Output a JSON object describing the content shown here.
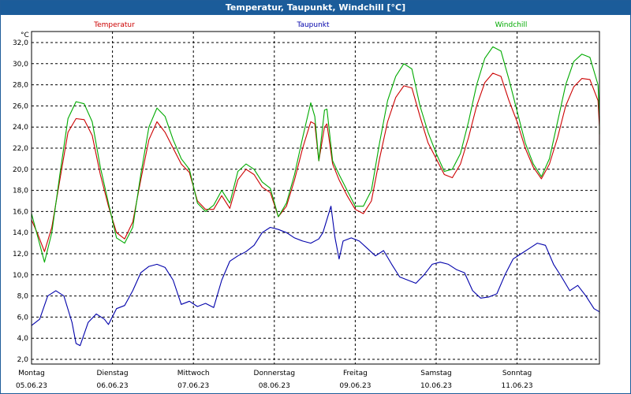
{
  "title": "Temperatur, Taupunkt, Windchill [°C]",
  "chart_data": {
    "type": "line",
    "unit_label": "°C",
    "ylim": [
      2.0,
      32.0
    ],
    "y_ticks": [
      "2,0",
      "4,0",
      "6,0",
      "8,0",
      "10,0",
      "12,0",
      "14,0",
      "16,0",
      "18,0",
      "20,0",
      "22,0",
      "24,0",
      "26,0",
      "28,0",
      "30,0",
      "32,0"
    ],
    "x_days": [
      {
        "day": "Montag",
        "date": "05.06.23"
      },
      {
        "day": "Dienstag",
        "date": "06.06.23"
      },
      {
        "day": "Mittwoch",
        "date": "07.06.23"
      },
      {
        "day": "Donnerstag",
        "date": "08.06.23"
      },
      {
        "day": "Freitag",
        "date": "09.06.23"
      },
      {
        "day": "Samstag",
        "date": "10.06.23"
      },
      {
        "day": "Sonntag",
        "date": "11.06.23"
      }
    ],
    "grid": true,
    "series": [
      {
        "name": "Temperatur",
        "color": "#cc0000",
        "points": [
          [
            0.0,
            15.2
          ],
          [
            0.08,
            13.8
          ],
          [
            0.16,
            12.2
          ],
          [
            0.25,
            14.5
          ],
          [
            0.35,
            19.0
          ],
          [
            0.45,
            23.5
          ],
          [
            0.55,
            24.8
          ],
          [
            0.65,
            24.7
          ],
          [
            0.75,
            23.2
          ],
          [
            0.85,
            19.5
          ],
          [
            0.95,
            16.5
          ],
          [
            1.05,
            14.0
          ],
          [
            1.15,
            13.4
          ],
          [
            1.25,
            15.0
          ],
          [
            1.35,
            19.0
          ],
          [
            1.45,
            22.8
          ],
          [
            1.55,
            24.5
          ],
          [
            1.65,
            23.5
          ],
          [
            1.75,
            22.0
          ],
          [
            1.85,
            20.5
          ],
          [
            1.95,
            19.7
          ],
          [
            2.05,
            17.0
          ],
          [
            2.15,
            16.2
          ],
          [
            2.25,
            16.2
          ],
          [
            2.35,
            17.5
          ],
          [
            2.45,
            16.3
          ],
          [
            2.55,
            19.0
          ],
          [
            2.65,
            20.0
          ],
          [
            2.75,
            19.5
          ],
          [
            2.85,
            18.3
          ],
          [
            2.95,
            17.8
          ],
          [
            3.05,
            15.5
          ],
          [
            3.15,
            16.5
          ],
          [
            3.25,
            19.0
          ],
          [
            3.35,
            22.0
          ],
          [
            3.45,
            24.5
          ],
          [
            3.5,
            24.3
          ],
          [
            3.55,
            20.8
          ],
          [
            3.62,
            24.0
          ],
          [
            3.65,
            24.3
          ],
          [
            3.72,
            20.5
          ],
          [
            3.8,
            19.0
          ],
          [
            3.9,
            17.5
          ],
          [
            4.0,
            16.2
          ],
          [
            4.1,
            15.8
          ],
          [
            4.2,
            17.0
          ],
          [
            4.3,
            21.0
          ],
          [
            4.4,
            24.5
          ],
          [
            4.5,
            26.8
          ],
          [
            4.6,
            27.9
          ],
          [
            4.7,
            27.7
          ],
          [
            4.8,
            25.0
          ],
          [
            4.9,
            22.5
          ],
          [
            5.0,
            21.0
          ],
          [
            5.1,
            19.5
          ],
          [
            5.2,
            19.2
          ],
          [
            5.3,
            20.5
          ],
          [
            5.4,
            23.0
          ],
          [
            5.5,
            26.0
          ],
          [
            5.6,
            28.2
          ],
          [
            5.7,
            29.1
          ],
          [
            5.8,
            28.8
          ],
          [
            5.9,
            26.5
          ],
          [
            6.0,
            24.5
          ],
          [
            6.1,
            22.0
          ],
          [
            6.2,
            20.2
          ],
          [
            6.3,
            19.1
          ],
          [
            6.4,
            20.5
          ],
          [
            6.5,
            23.0
          ],
          [
            6.6,
            26.0
          ],
          [
            6.7,
            27.8
          ],
          [
            6.8,
            28.6
          ],
          [
            6.9,
            28.5
          ],
          [
            7.0,
            26.5
          ],
          [
            7.1,
            24.0
          ],
          [
            7.2,
            22.3
          ]
        ]
      },
      {
        "name": "Taupunkt",
        "color": "#0000aa",
        "points": [
          [
            0.0,
            5.2
          ],
          [
            0.1,
            5.8
          ],
          [
            0.2,
            8.0
          ],
          [
            0.3,
            8.5
          ],
          [
            0.4,
            8.0
          ],
          [
            0.5,
            5.5
          ],
          [
            0.55,
            3.5
          ],
          [
            0.6,
            3.3
          ],
          [
            0.7,
            5.5
          ],
          [
            0.8,
            6.3
          ],
          [
            0.9,
            5.8
          ],
          [
            0.95,
            5.3
          ],
          [
            1.05,
            6.8
          ],
          [
            1.15,
            7.1
          ],
          [
            1.25,
            8.5
          ],
          [
            1.35,
            10.2
          ],
          [
            1.45,
            10.8
          ],
          [
            1.55,
            11.0
          ],
          [
            1.65,
            10.7
          ],
          [
            1.75,
            9.5
          ],
          [
            1.85,
            7.2
          ],
          [
            1.95,
            7.5
          ],
          [
            2.05,
            7.0
          ],
          [
            2.15,
            7.3
          ],
          [
            2.25,
            6.9
          ],
          [
            2.35,
            9.5
          ],
          [
            2.45,
            11.3
          ],
          [
            2.55,
            11.8
          ],
          [
            2.65,
            12.2
          ],
          [
            2.75,
            12.8
          ],
          [
            2.85,
            14.0
          ],
          [
            2.95,
            14.5
          ],
          [
            3.05,
            14.3
          ],
          [
            3.15,
            14.0
          ],
          [
            3.25,
            13.5
          ],
          [
            3.35,
            13.2
          ],
          [
            3.45,
            13.0
          ],
          [
            3.55,
            13.4
          ],
          [
            3.6,
            14.0
          ],
          [
            3.7,
            16.5
          ],
          [
            3.75,
            13.5
          ],
          [
            3.8,
            11.5
          ],
          [
            3.85,
            13.2
          ],
          [
            3.95,
            13.5
          ],
          [
            4.05,
            13.2
          ],
          [
            4.15,
            12.5
          ],
          [
            4.25,
            11.8
          ],
          [
            4.35,
            12.3
          ],
          [
            4.45,
            11.0
          ],
          [
            4.55,
            9.8
          ],
          [
            4.65,
            9.5
          ],
          [
            4.75,
            9.2
          ],
          [
            4.85,
            10.0
          ],
          [
            4.95,
            11.0
          ],
          [
            5.05,
            11.2
          ],
          [
            5.15,
            11.0
          ],
          [
            5.25,
            10.5
          ],
          [
            5.35,
            10.2
          ],
          [
            5.45,
            8.5
          ],
          [
            5.55,
            7.8
          ],
          [
            5.65,
            7.9
          ],
          [
            5.75,
            8.2
          ],
          [
            5.85,
            10.0
          ],
          [
            5.95,
            11.5
          ],
          [
            6.05,
            12.0
          ],
          [
            6.15,
            12.5
          ],
          [
            6.25,
            13.0
          ],
          [
            6.35,
            12.8
          ],
          [
            6.45,
            11.0
          ],
          [
            6.55,
            9.8
          ],
          [
            6.65,
            8.5
          ],
          [
            6.75,
            9.0
          ],
          [
            6.85,
            8.0
          ],
          [
            6.95,
            6.8
          ],
          [
            7.05,
            6.5
          ],
          [
            7.15,
            6.3
          ]
        ]
      },
      {
        "name": "Windchill",
        "color": "#00aa00",
        "points": [
          [
            0.0,
            15.8
          ],
          [
            0.08,
            13.5
          ],
          [
            0.16,
            11.2
          ],
          [
            0.25,
            14.0
          ],
          [
            0.35,
            19.5
          ],
          [
            0.45,
            24.8
          ],
          [
            0.55,
            26.4
          ],
          [
            0.65,
            26.2
          ],
          [
            0.75,
            24.5
          ],
          [
            0.85,
            20.2
          ],
          [
            0.95,
            16.8
          ],
          [
            1.05,
            13.5
          ],
          [
            1.15,
            13.0
          ],
          [
            1.25,
            14.5
          ],
          [
            1.35,
            19.5
          ],
          [
            1.45,
            24.0
          ],
          [
            1.55,
            25.8
          ],
          [
            1.65,
            25.0
          ],
          [
            1.75,
            22.8
          ],
          [
            1.85,
            21.0
          ],
          [
            1.95,
            20.0
          ],
          [
            2.05,
            16.8
          ],
          [
            2.15,
            16.0
          ],
          [
            2.25,
            16.6
          ],
          [
            2.35,
            18.0
          ],
          [
            2.45,
            16.8
          ],
          [
            2.55,
            19.8
          ],
          [
            2.65,
            20.5
          ],
          [
            2.75,
            20.0
          ],
          [
            2.85,
            18.8
          ],
          [
            2.95,
            18.2
          ],
          [
            3.05,
            15.5
          ],
          [
            3.15,
            16.8
          ],
          [
            3.25,
            19.5
          ],
          [
            3.35,
            23.0
          ],
          [
            3.45,
            26.3
          ],
          [
            3.5,
            25.0
          ],
          [
            3.55,
            20.8
          ],
          [
            3.62,
            25.6
          ],
          [
            3.65,
            25.7
          ],
          [
            3.72,
            20.8
          ],
          [
            3.8,
            19.5
          ],
          [
            3.9,
            18.0
          ],
          [
            4.0,
            16.5
          ],
          [
            4.1,
            16.5
          ],
          [
            4.2,
            18.0
          ],
          [
            4.3,
            22.5
          ],
          [
            4.4,
            26.5
          ],
          [
            4.5,
            28.8
          ],
          [
            4.6,
            30.0
          ],
          [
            4.7,
            29.5
          ],
          [
            4.8,
            26.0
          ],
          [
            4.9,
            23.5
          ],
          [
            5.0,
            21.5
          ],
          [
            5.1,
            19.8
          ],
          [
            5.2,
            20.0
          ],
          [
            5.3,
            21.5
          ],
          [
            5.4,
            24.5
          ],
          [
            5.5,
            28.0
          ],
          [
            5.6,
            30.5
          ],
          [
            5.7,
            31.6
          ],
          [
            5.8,
            31.2
          ],
          [
            5.9,
            28.5
          ],
          [
            6.0,
            25.5
          ],
          [
            6.1,
            22.5
          ],
          [
            6.2,
            20.5
          ],
          [
            6.3,
            19.3
          ],
          [
            6.4,
            21.0
          ],
          [
            6.5,
            24.5
          ],
          [
            6.6,
            28.0
          ],
          [
            6.7,
            30.2
          ],
          [
            6.8,
            30.9
          ],
          [
            6.9,
            30.6
          ],
          [
            7.0,
            28.0
          ],
          [
            7.1,
            25.0
          ],
          [
            7.2,
            23.3
          ]
        ]
      }
    ]
  }
}
